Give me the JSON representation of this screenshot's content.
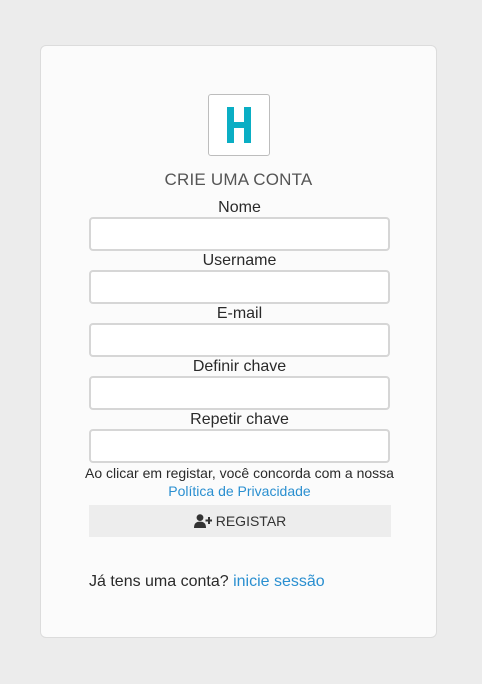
{
  "form": {
    "title": "CRIE UMA CONTA",
    "fields": [
      {
        "label": "Nome",
        "value": ""
      },
      {
        "label": "Username",
        "value": ""
      },
      {
        "label": "E-mail",
        "value": ""
      },
      {
        "label": "Definir chave",
        "value": ""
      },
      {
        "label": "Repetir chave",
        "value": ""
      }
    ],
    "terms_text": "Ao clicar em registar, você concorda com a nossa",
    "privacy_link": "Política de Privacidade",
    "register_label": "REGISTAR",
    "register_icon": "user-plus-icon"
  },
  "footer": {
    "question": "Já tens uma conta?",
    "login_link": "inicie sessão"
  },
  "logo": {
    "icon": "h-logo",
    "color": "#0aaec4"
  },
  "colors": {
    "link": "#2a8fd0",
    "background": "#ececec",
    "card": "#fbfbfb",
    "button": "#ededed"
  }
}
